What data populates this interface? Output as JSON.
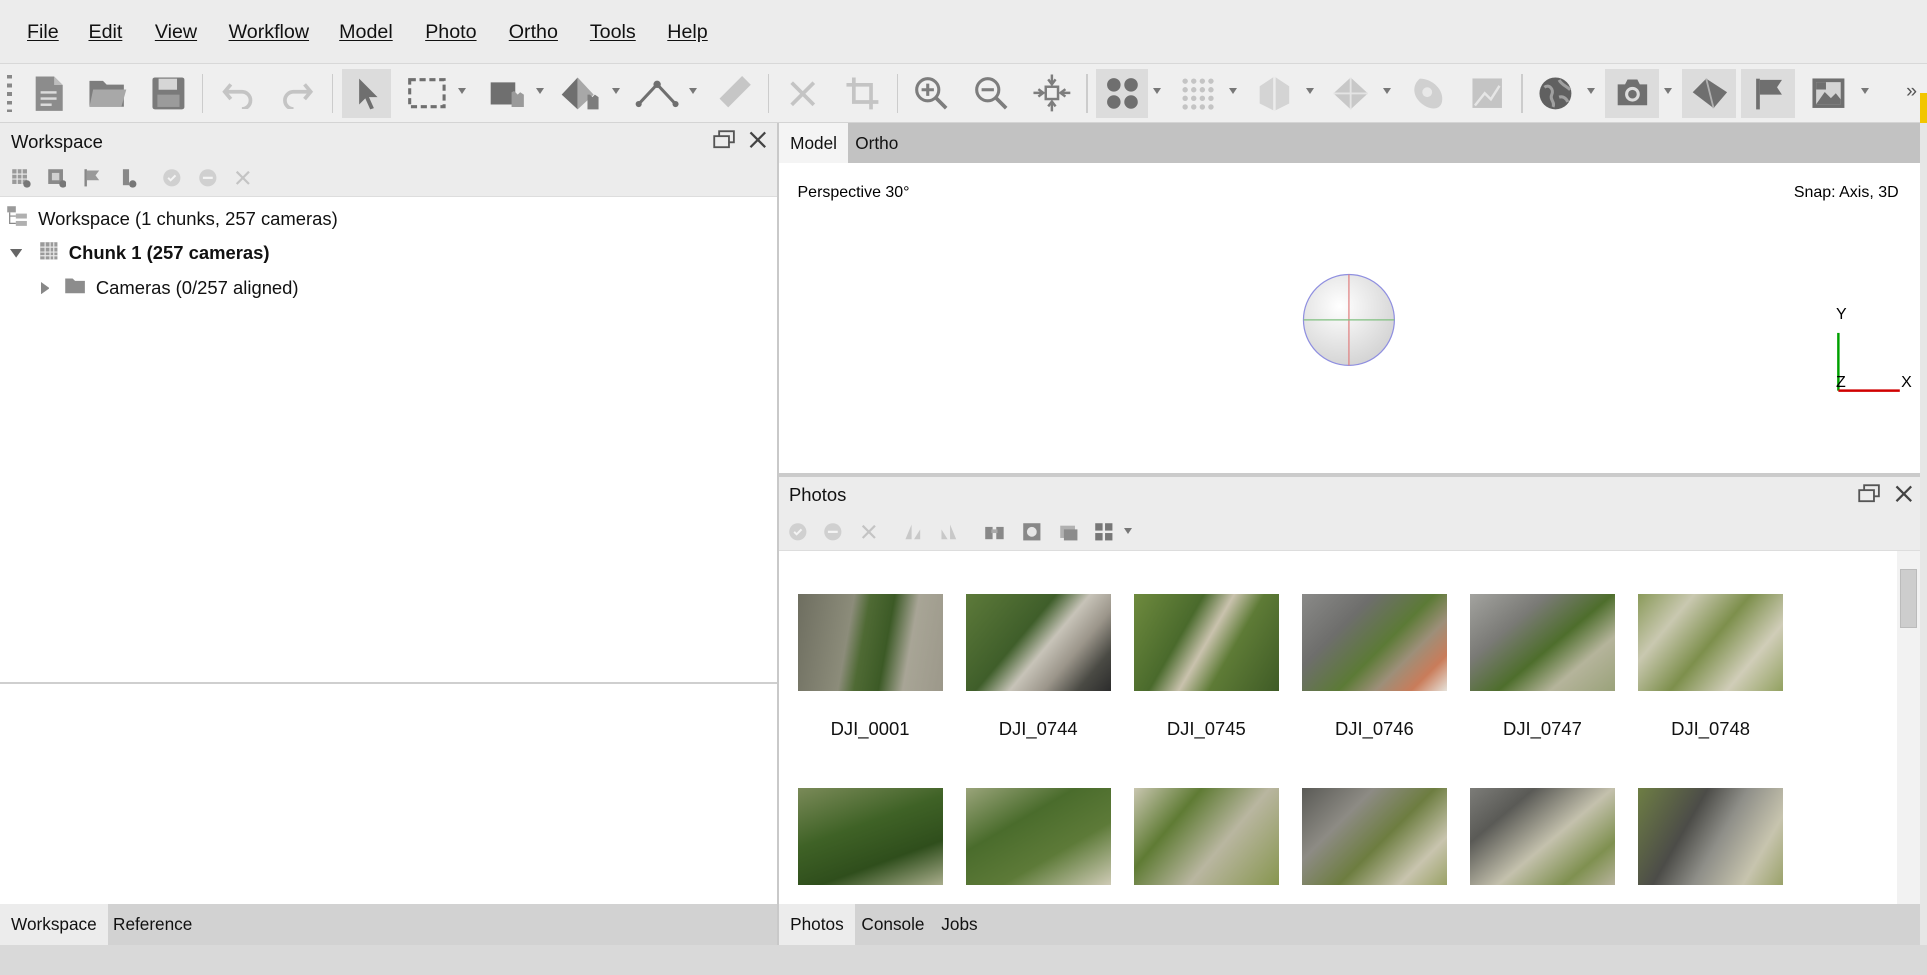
{
  "menu": [
    "File",
    "Edit",
    "View",
    "Workflow",
    "Model",
    "Photo",
    "Ortho",
    "Tools",
    "Help"
  ],
  "colors": {
    "accent": "#f2c600",
    "axis_x": "#d00000",
    "axis_y": "#00a000",
    "panel": "#ececec",
    "tab_inactive": "#c2c2c2"
  },
  "toolbar_icons": [
    "new-file-icon",
    "open-folder-icon",
    "save-icon",
    "undo-icon",
    "redo-icon",
    "select-pointer-icon",
    "rectangle-selection-icon",
    "paint-selection-icon",
    "free-form-selection-icon",
    "ruler-tool-icon",
    "measure-tool-icon",
    "delete-icon",
    "crop-icon",
    "zoom-in-icon",
    "zoom-out-icon",
    "reset-view-icon",
    "show-cameras-icon",
    "show-points-icon",
    "show-dense-cloud-icon",
    "show-mesh-icon",
    "show-texture-icon",
    "show-tiled-model-icon",
    "show-dem-icon",
    "show-camera-icon",
    "show-shapes-icon",
    "show-markers-icon",
    "show-image-icon"
  ],
  "workspace": {
    "title": "Workspace",
    "root_label": "Workspace (1 chunks, 257 cameras)",
    "chunk_label": "Chunk 1 (257 cameras)",
    "cameras_label": "Cameras (0/257 aligned)"
  },
  "left_tabs": [
    "Workspace",
    "Reference"
  ],
  "model_tabs": [
    "Model",
    "Ortho"
  ],
  "model_view": {
    "projection": "Perspective 30°",
    "snap": "Snap: Axis, 3D",
    "axis_x": "X",
    "axis_y": "Y",
    "axis_z": "Z"
  },
  "photos": {
    "title": "Photos",
    "items": [
      {
        "label": "DJI_0001",
        "scene": "tree"
      },
      {
        "label": "DJI_0744",
        "scene": "parking"
      },
      {
        "label": "DJI_0745",
        "scene": "path"
      },
      {
        "label": "DJI_0746",
        "scene": "building"
      },
      {
        "label": "DJI_0747",
        "scene": "building2"
      },
      {
        "label": "DJI_0748",
        "scene": "garden"
      },
      {
        "label": "",
        "scene": "trees"
      },
      {
        "label": "",
        "scene": "trees2"
      },
      {
        "label": "",
        "scene": "garden2"
      },
      {
        "label": "",
        "scene": "roof"
      },
      {
        "label": "",
        "scene": "roof2"
      },
      {
        "label": "",
        "scene": "roof3"
      }
    ]
  },
  "right_tabs": [
    "Photos",
    "Console",
    "Jobs"
  ]
}
